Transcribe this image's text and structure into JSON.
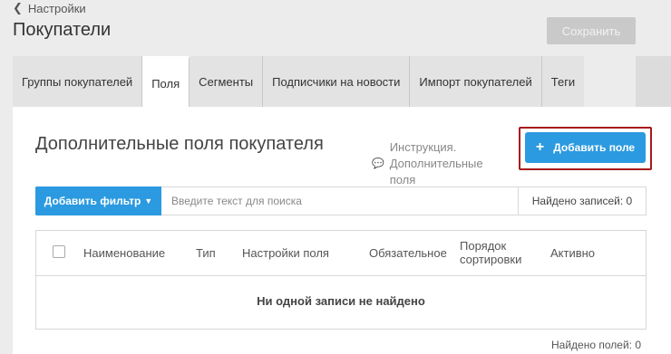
{
  "breadcrumb": {
    "back_label": "Настройки"
  },
  "header": {
    "title": "Покупатели",
    "save_label": "Сохранить"
  },
  "tabs": [
    {
      "label": "Группы покупателей",
      "active": false
    },
    {
      "label": "Поля",
      "active": true
    },
    {
      "label": "Сегменты",
      "active": false
    },
    {
      "label": "Подписчики на новости",
      "active": false
    },
    {
      "label": "Импорт покупателей",
      "active": false
    },
    {
      "label": "Теги",
      "active": false
    }
  ],
  "section": {
    "title": "Дополнительные поля покупателя",
    "instruction": "Инструкция. Дополнительные поля",
    "add_button_label": "Добавить поле"
  },
  "filter": {
    "add_filter_label": "Добавить фильтр",
    "search_placeholder": "Введите текст для поиска",
    "found_records": "Найдено записей: 0"
  },
  "table": {
    "columns": [
      "Наименование",
      "Тип",
      "Настройки поля",
      "Обязательное",
      "Порядок сортировки",
      "Активно"
    ],
    "empty_message": "Ни одной записи не найдено"
  },
  "footer": {
    "found_fields": "Найдено полей: 0"
  },
  "colors": {
    "accent": "#2b9ae0",
    "highlight_outline": "#a51a1a",
    "save_disabled": "#c9c9c9"
  }
}
